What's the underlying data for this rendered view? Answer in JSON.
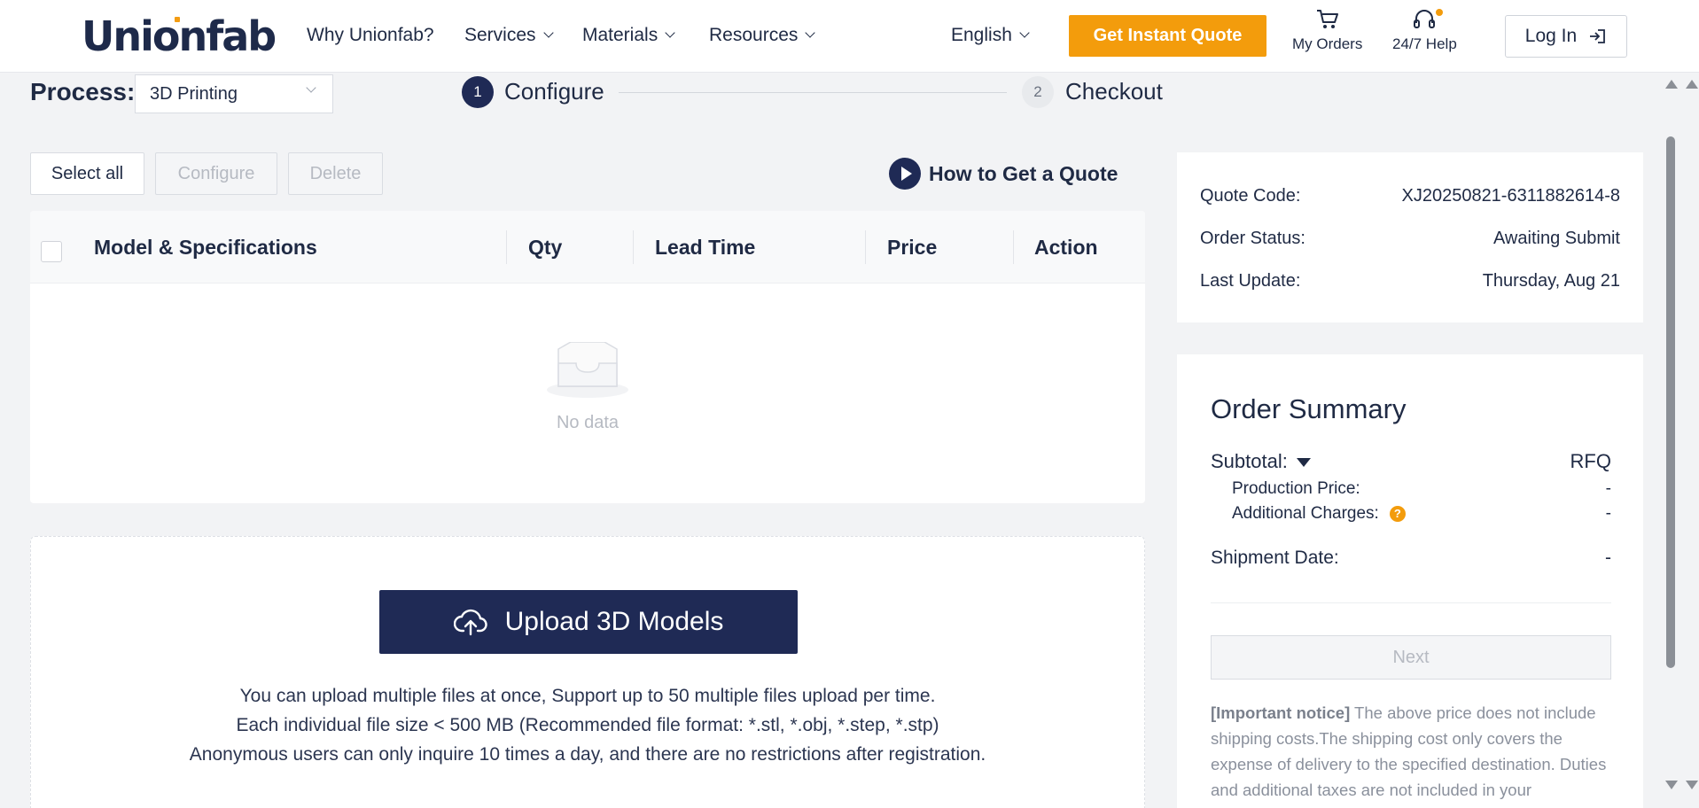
{
  "header": {
    "logo": "Unionfab",
    "nav": [
      {
        "label": "Why Unionfab?",
        "dropdown": false
      },
      {
        "label": "Services",
        "dropdown": true
      },
      {
        "label": "Materials",
        "dropdown": true
      },
      {
        "label": "Resources",
        "dropdown": true
      }
    ],
    "language": "English",
    "quote_button": "Get Instant Quote",
    "orders_label": "My Orders",
    "help_label": "24/7 Help",
    "login_label": "Log In"
  },
  "process": {
    "label": "Process:",
    "selected": "3D Printing"
  },
  "steps": [
    {
      "number": "1",
      "label": "Configure",
      "active": true
    },
    {
      "number": "2",
      "label": "Checkout",
      "active": false
    }
  ],
  "toolbar": {
    "select_all": "Select all",
    "configure": "Configure",
    "delete": "Delete",
    "how_to": "How to Get a Quote"
  },
  "table": {
    "columns": [
      "Model & Specifications",
      "Qty",
      "Lead Time",
      "Price",
      "Action"
    ],
    "empty_text": "No data"
  },
  "upload": {
    "button": "Upload 3D Models",
    "notes": [
      "You can upload multiple files at once, Support up to 50 multiple files upload per time.",
      "Each individual file size < 500 MB (Recommended file format: *.stl, *.obj, *.step, *.stp)",
      "Anonymous users can only inquire 10 times a day, and there are no restrictions after registration."
    ]
  },
  "quote_info": {
    "code_label": "Quote Code:",
    "code_value": "XJ20250821-6311882614-8",
    "status_label": "Order Status:",
    "status_value": "Awaiting Submit",
    "update_label": "Last Update:",
    "update_value": "Thursday, Aug 21"
  },
  "summary": {
    "title": "Order Summary",
    "subtotal_label": "Subtotal:",
    "subtotal_value": "RFQ",
    "production_label": "Production Price:",
    "production_value": "-",
    "additional_label": "Additional Charges:",
    "additional_value": "-",
    "help_mark": "?",
    "shipment_label": "Shipment Date:",
    "shipment_value": "-",
    "next_button": "Next",
    "notice_title": "[Important notice]",
    "notice_text": " The above price does not include shipping costs.The shipping cost only covers the expense of delivery to the specified destination. Duties and additional taxes are not included in your"
  },
  "colors": {
    "accent": "#f39c0c",
    "primary": "#1f2a55"
  }
}
